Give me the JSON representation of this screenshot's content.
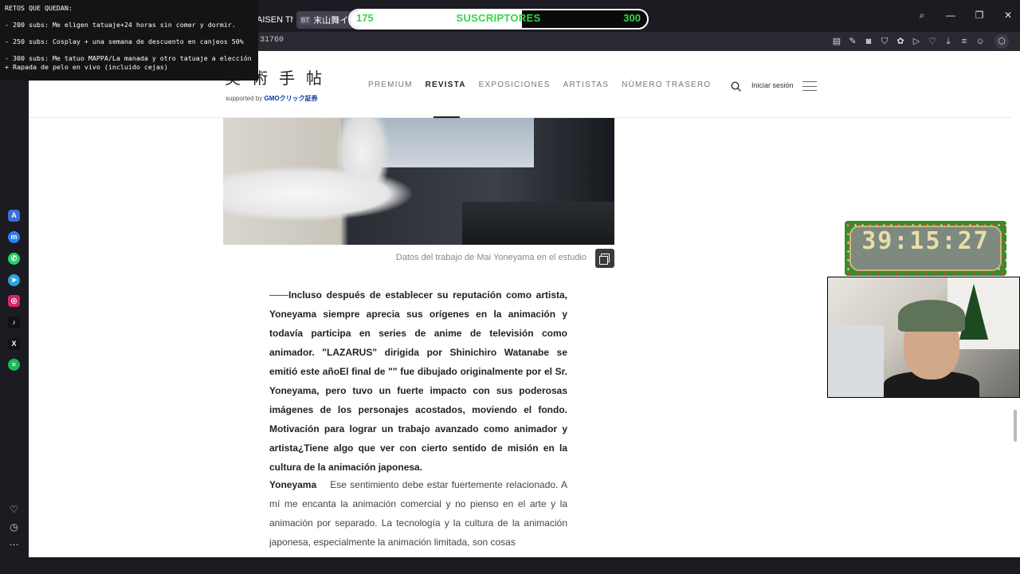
{
  "browser": {
    "tabs": [
      {
        "title": "AISEN The C"
      },
      {
        "favicon": "BT",
        "title": "末山舞インタビ"
      }
    ],
    "url_fragment": "31760",
    "window_controls": [
      "search-icon",
      "minimize-icon",
      "restore-icon",
      "close-icon"
    ]
  },
  "sub_goal": {
    "current": "175",
    "label": "SUSCRIPTORES",
    "target": "300",
    "progress_fraction": 0.58,
    "color": "#39d34a"
  },
  "retos": {
    "title": "RETOS QUE QUEDAN:",
    "items": [
      "- 200 subs: Me eligen tatuaje+24 horas sin comer y dormir.",
      "- 250 subs: Cosplay + una semana de descuento en canjeos 50%",
      "- 300 subs: Me tatuo MAPPA/La manada y otro tatuaje a elección",
      "+ Rapada de pelo en vivo (incluido cejas)"
    ]
  },
  "site": {
    "logo": "美術手帖",
    "sponsor_prefix": "supported by",
    "sponsor_brand": "GMOクリック証券",
    "nav": [
      "PREMIUM",
      "REVISTA",
      "EXPOSICIONES",
      "ARTISTAS",
      "NÚMERO TRASERO"
    ],
    "active_nav": "REVISTA",
    "login": "Iniciar sesión"
  },
  "article": {
    "caption": "Datos del trabajo de Mai Yoneyama en el estudio",
    "question": "Incluso después de establecer su reputación como artista, Yoneyama siempre aprecia sus orígenes en la animación y todavía participa en series de anime de televisión como animador. \"LAZARUS\" dirigida por Shinichiro Watanabe se emitió este añoEl final de \"\" fue dibujado originalmente por el Sr. Yoneyama, pero tuvo un fuerte impacto con sus poderosas imágenes de los personajes acostados, moviendo el fondo. Motivación para lograr un trabajo avanzado como animador y artista¿Tiene algo que ver con cierto sentido de misión en la cultura de la animación japonesa.",
    "answer_speaker": "Yoneyama",
    "answer": "Ese sentimiento debe estar fuertemente relacionado. A mí me encanta la animación comercial y no pienso en el arte y la animación por separado. La tecnología y la cultura de la animación japonesa, especialmente la animación limitada, son cosas"
  },
  "timer": {
    "value": "39:15:27"
  },
  "sidebar_icons": [
    "aria-icon",
    "messenger-icon",
    "whatsapp-icon",
    "telegram-icon",
    "instagram-icon",
    "tiktok-icon",
    "x-icon",
    "spotify-icon"
  ],
  "sidebar_bottom_icons": [
    "heart-icon",
    "history-icon",
    "more-icon"
  ]
}
